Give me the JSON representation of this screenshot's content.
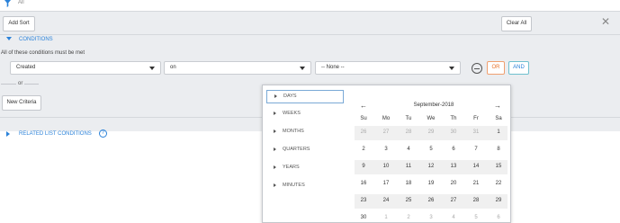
{
  "top": {
    "all_label": "All"
  },
  "toolbar": {
    "add_sort": "Add Sort",
    "clear_all": "Clear All",
    "close": "✕"
  },
  "conditions": {
    "header": "CONDITIONS",
    "all_met_label": "All of these conditions must be met",
    "field_value": "Created",
    "operator_value": "on",
    "value_value": "-- None --",
    "or_button": "OR",
    "and_button": "AND",
    "or_separator": "or",
    "new_criteria": "New Criteria"
  },
  "related": {
    "label": "RELATED LIST CONDITIONS",
    "help": "?"
  },
  "colors": {
    "accent": "#2b82d9",
    "or_color": "#e8742c",
    "panel_bg": "#ebedf0"
  },
  "units": [
    {
      "label": "DAYS",
      "active": true
    },
    {
      "label": "WEEKS",
      "active": false
    },
    {
      "label": "MONTHS",
      "active": false
    },
    {
      "label": "QUARTERS",
      "active": false
    },
    {
      "label": "YEARS",
      "active": false
    },
    {
      "label": "MINUTES",
      "active": false
    }
  ],
  "calendar": {
    "prev": "←",
    "next": "→",
    "month_label": "September-2018",
    "weekdays": [
      "Su",
      "Mo",
      "Tu",
      "We",
      "Th",
      "Fr",
      "Sa"
    ],
    "weeks": [
      [
        "26",
        "27",
        "28",
        "29",
        "30",
        "31",
        "1"
      ],
      [
        "2",
        "3",
        "4",
        "5",
        "6",
        "7",
        "8"
      ],
      [
        "9",
        "10",
        "11",
        "12",
        "13",
        "14",
        "15"
      ],
      [
        "16",
        "17",
        "18",
        "19",
        "20",
        "21",
        "22"
      ],
      [
        "23",
        "24",
        "25",
        "26",
        "27",
        "28",
        "29"
      ],
      [
        "30",
        "1",
        "2",
        "3",
        "4",
        "5",
        "6"
      ]
    ],
    "muted": [
      [
        true,
        true,
        true,
        true,
        true,
        true,
        false
      ],
      [
        false,
        false,
        false,
        false,
        false,
        false,
        false
      ],
      [
        false,
        false,
        false,
        false,
        false,
        false,
        false
      ],
      [
        false,
        false,
        false,
        false,
        false,
        false,
        false
      ],
      [
        false,
        false,
        false,
        false,
        false,
        false,
        false
      ],
      [
        false,
        true,
        true,
        true,
        true,
        true,
        true
      ]
    ]
  }
}
